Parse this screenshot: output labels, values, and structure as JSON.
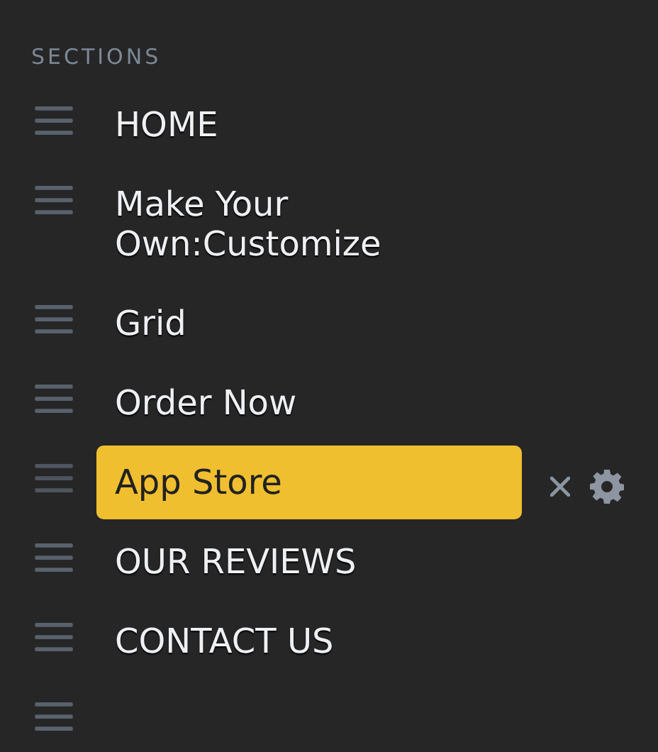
{
  "heading": "SECTIONS",
  "items": [
    {
      "label": "HOME",
      "selected": false
    },
    {
      "label": "Make Your Own:Customize",
      "selected": false
    },
    {
      "label": "Grid",
      "selected": false
    },
    {
      "label": "Order Now",
      "selected": false
    },
    {
      "label": "App Store",
      "selected": true
    },
    {
      "label": "OUR REVIEWS",
      "selected": false
    },
    {
      "label": "CONTACT US",
      "selected": false
    },
    {
      "selected": false
    }
  ]
}
